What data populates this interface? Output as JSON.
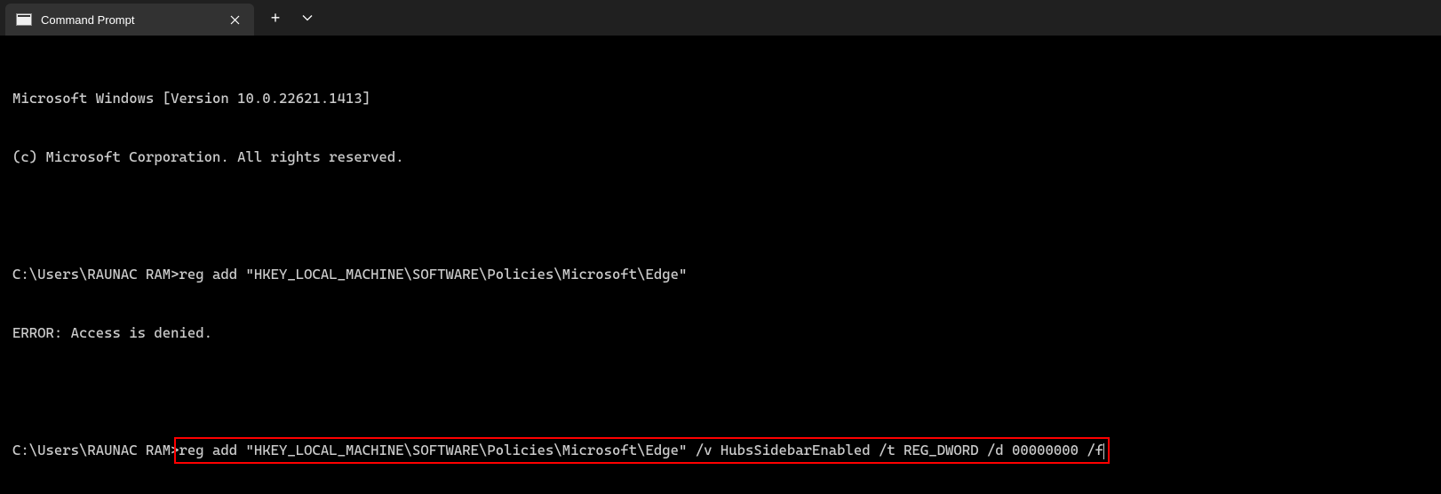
{
  "tab": {
    "title": "Command Prompt"
  },
  "terminal": {
    "line1": "Microsoft Windows [Version 10.0.22621.1413]",
    "line2": "(c) Microsoft Corporation. All rights reserved.",
    "prompt1": "C:\\Users\\RAUNAC RAM>",
    "command1": "reg add \"HKEY_LOCAL_MACHINE\\SOFTWARE\\Policies\\Microsoft\\Edge\"",
    "error1": "ERROR: Access is denied.",
    "prompt2": "C:\\Users\\RAUNAC RAM>",
    "command2": "reg add \"HKEY_LOCAL_MACHINE\\SOFTWARE\\Policies\\Microsoft\\Edge\" /v HubsSidebarEnabled /t REG_DWORD /d 00000000 /f"
  }
}
